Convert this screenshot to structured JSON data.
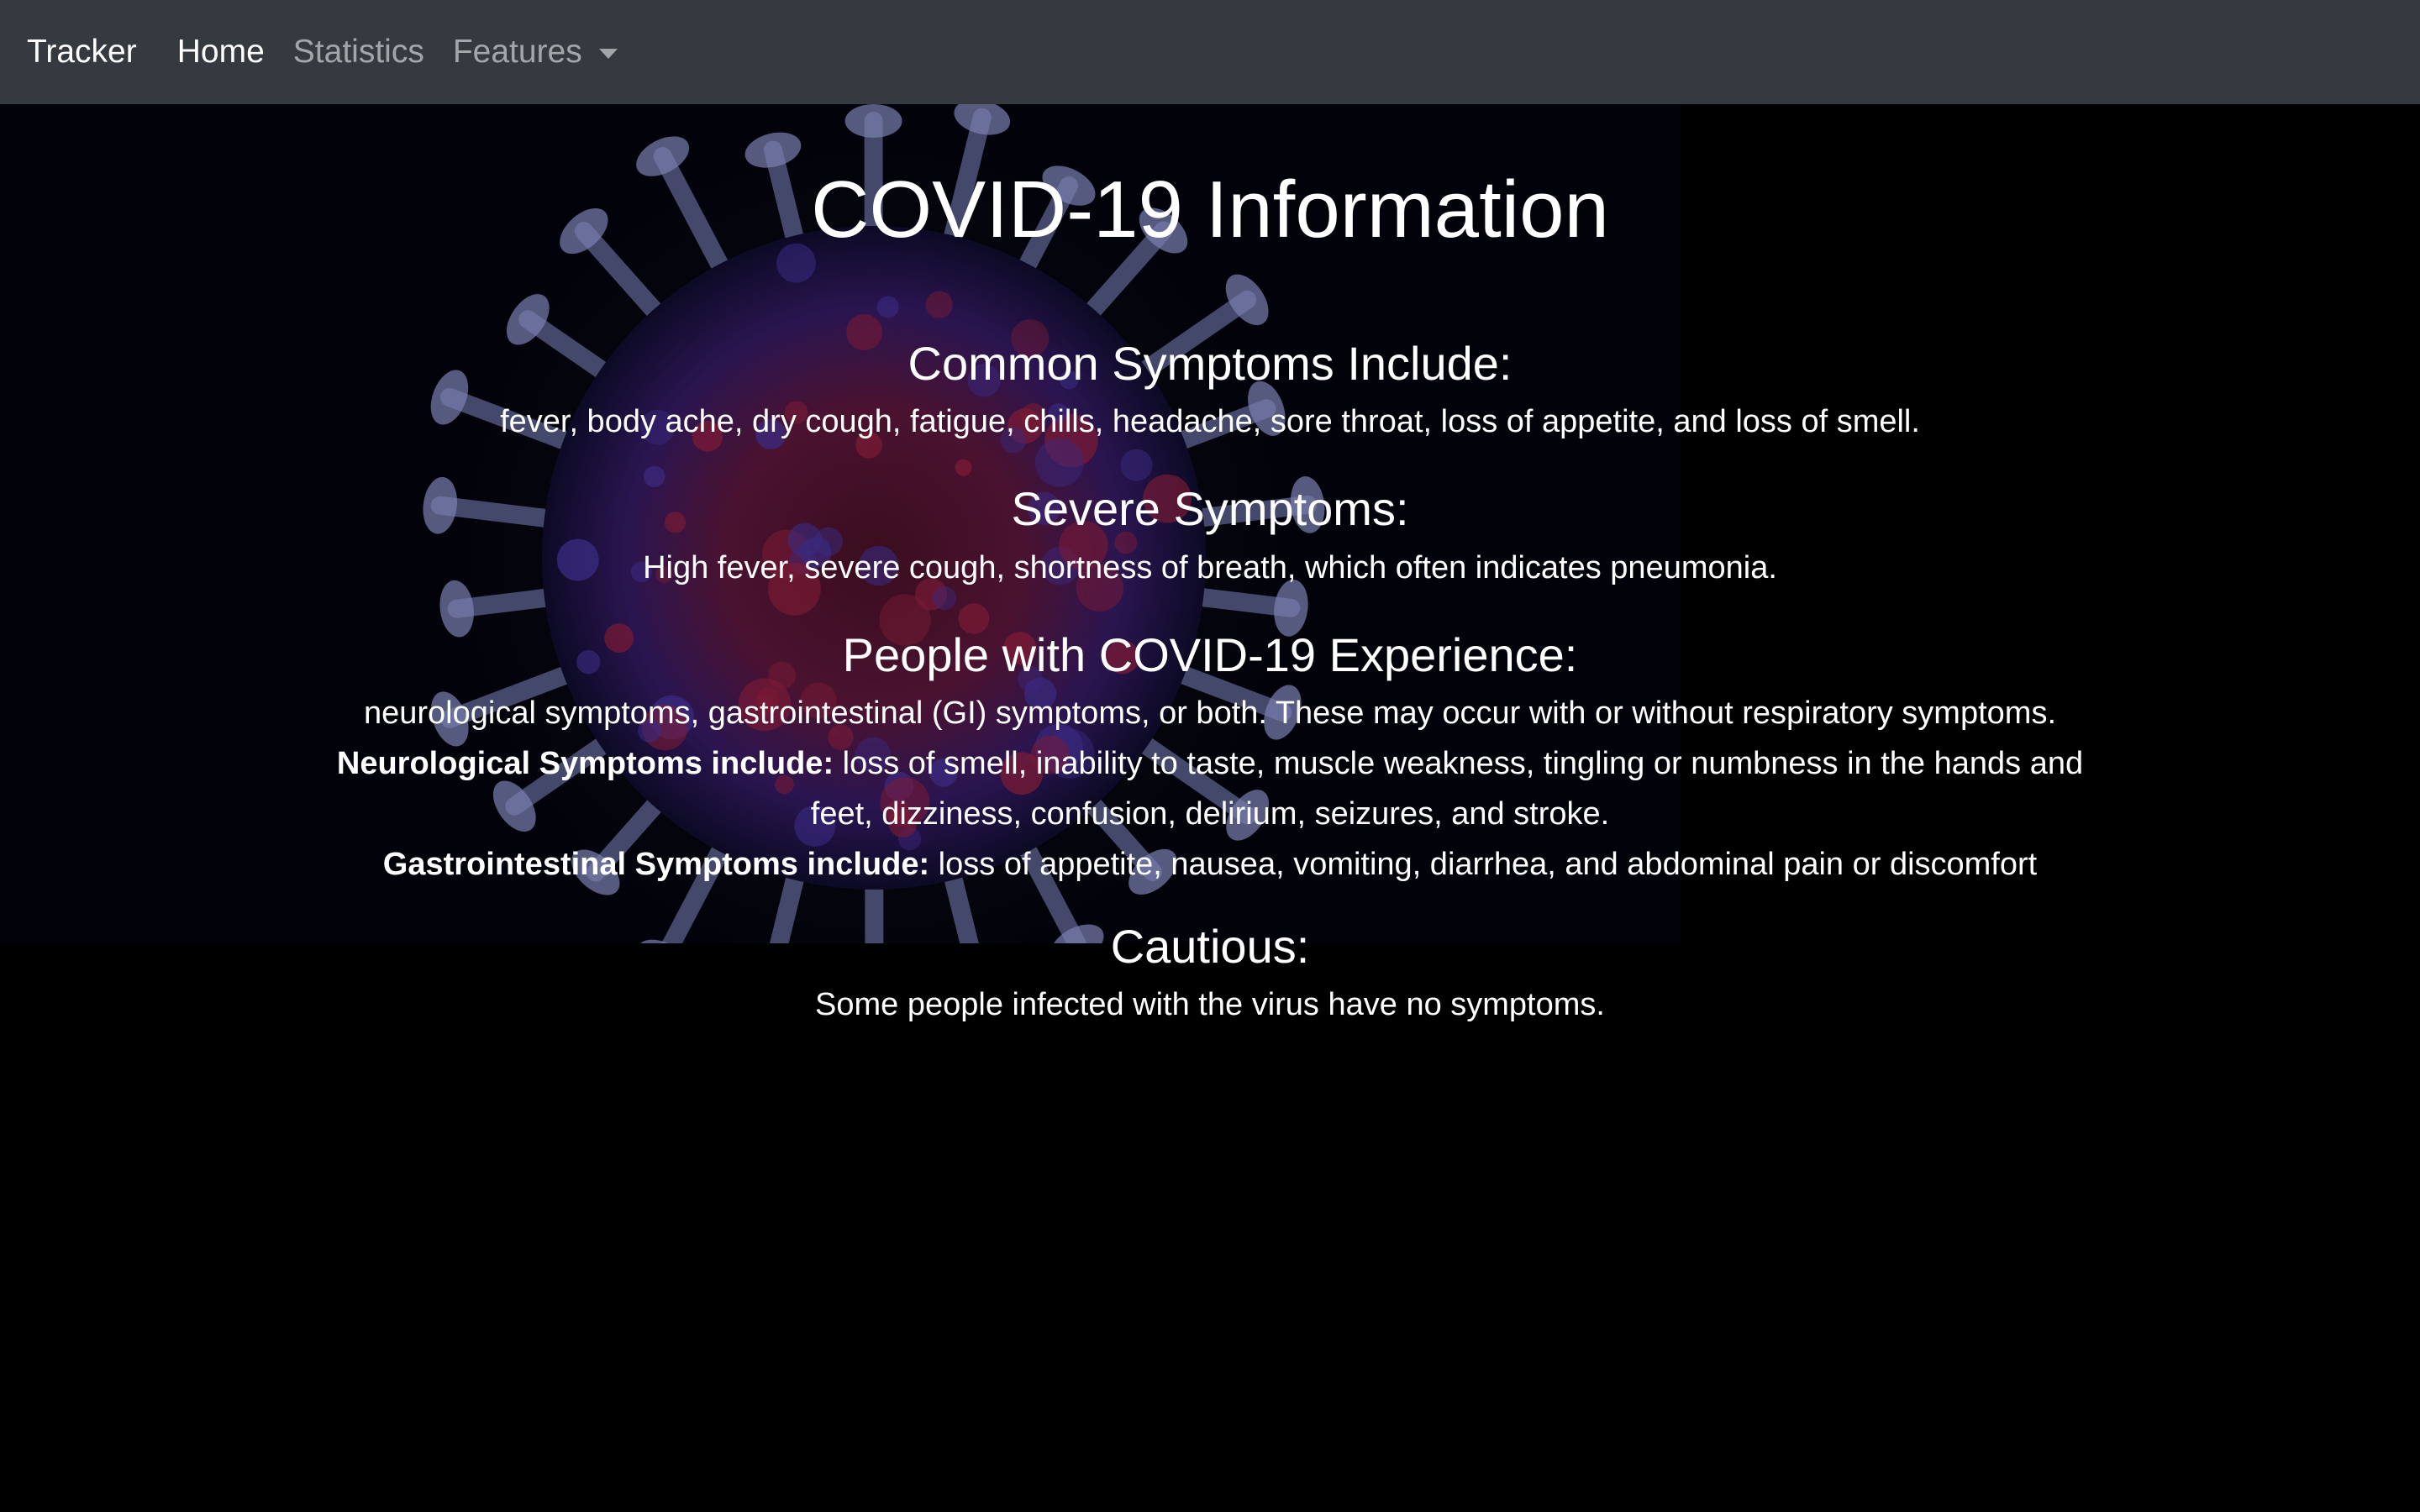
{
  "navbar": {
    "brand": "Tracker",
    "links": [
      {
        "label": "Home",
        "active": true
      },
      {
        "label": "Statistics",
        "active": false
      },
      {
        "label": "Features",
        "active": false,
        "dropdown": true
      }
    ]
  },
  "main": {
    "title": "COVID-19 Information",
    "sections": [
      {
        "heading": "Common Symptoms Include:",
        "text": "fever, body ache, dry cough, fatigue, chills, headache, sore throat, loss of appetite, and loss of smell."
      },
      {
        "heading": "Severe Symptoms:",
        "text": "High fever, severe cough, shortness of breath, which often indicates pneumonia."
      },
      {
        "heading": "People with COVID-19 Experience:",
        "text": "neurological symptoms, gastrointestinal (GI) symptoms, or both. These may occur with or without respiratory symptoms.",
        "neuro_label": "Neurological Symptoms include:",
        "neuro_text": " loss of smell, inability to taste, muscle weakness, tingling or numbness in the hands and feet, dizziness, confusion, delirium, seizures, and stroke.",
        "gi_label": "Gastrointestinal Symptoms include:",
        "gi_text": " loss of appetite, nausea, vomiting, diarrhea, and abdominal pain or discomfort"
      },
      {
        "heading": "Cautious:",
        "text": "Some people infected with the virus have no symptoms."
      }
    ]
  },
  "colors": {
    "navbar_bg": "#343a40",
    "page_bg": "#000000",
    "text": "#ffffff",
    "nav_muted": "rgba(255,255,255,0.55)"
  },
  "icons": {
    "dropdown": "caret-down-icon"
  }
}
